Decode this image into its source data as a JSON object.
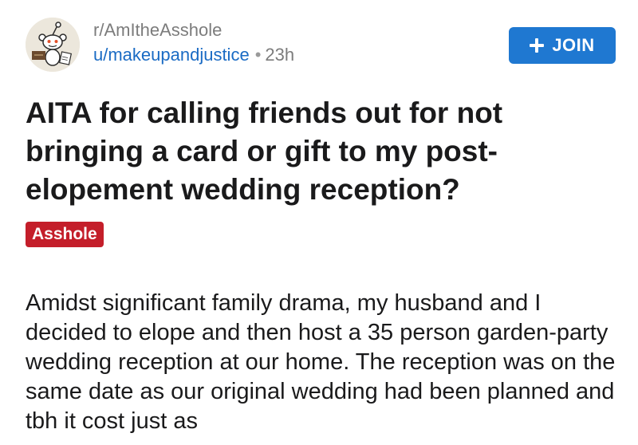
{
  "post": {
    "subreddit": "r/AmItheAsshole",
    "author": "u/makeupandjustice",
    "separator": "•",
    "age": "23h",
    "join_label": "JOIN",
    "title": "AITA for calling friends out for not bringing a card or gift to my post-elopement wedding reception?",
    "flair": "Asshole",
    "body": "Amidst significant family drama, my husband and I decided to elope and then host a 35 person garden-party wedding reception at our home. The reception was on the same date as our original wedding had been planned and tbh it cost just as"
  },
  "colors": {
    "join_button": "#1f78d1",
    "username_link": "#1a6bc4",
    "flair_background": "#c41e2a",
    "text": "#1a1a1b",
    "muted": "#7c7c7c"
  },
  "icons": {
    "avatar": "snoo-avatar-icon",
    "join": "plus-icon"
  }
}
